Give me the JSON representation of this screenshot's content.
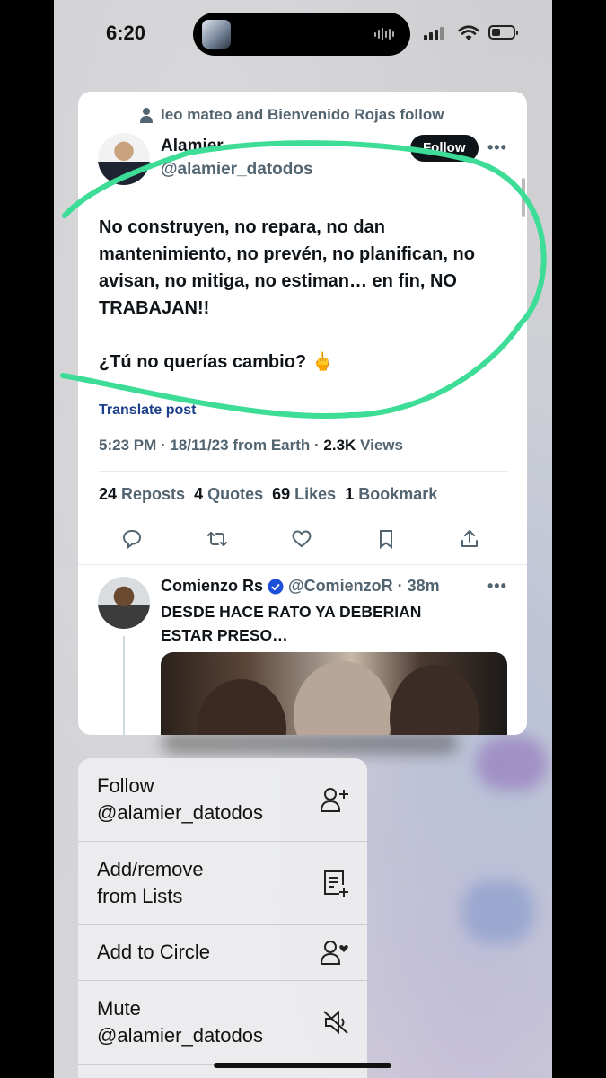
{
  "status_bar": {
    "time": "6:20"
  },
  "tweet": {
    "social_context": "leo mateo and Bienvenido Rojas follow",
    "author_name": "Alamier",
    "author_handle": "@alamier_datodos",
    "follow_label": "Follow",
    "body": "No construyen, no repara, no dan mantenimiento, no prevén, no planifican, no avisan, no mitiga, no estiman… en fin, NO TRABAJAN!!\n\n¿Tú no querías cambio? 🖕",
    "translate_label": "Translate post",
    "time": "5:23 PM",
    "date": "18/11/23",
    "source": "from Earth",
    "views_count": "2.3K",
    "views_label": "Views",
    "reposts_count": "24",
    "reposts_label": "Reposts",
    "quotes_count": "4",
    "quotes_label": "Quotes",
    "likes_count": "69",
    "likes_label": "Likes",
    "bookmarks_count": "1",
    "bookmarks_label": "Bookmark"
  },
  "reply": {
    "name": "Comienzo Rs",
    "handle": "@ComienzoR",
    "time": "38m",
    "body": "DESDE HACE RATO YA DEBERIAN ESTAR PRESO…"
  },
  "menu": {
    "items": [
      {
        "label": "Follow\n@alamier_datodos",
        "icon": "follow-icon"
      },
      {
        "label": "Add/remove\nfrom Lists",
        "icon": "list-add-icon"
      },
      {
        "label": "Add to Circle",
        "icon": "circle-icon"
      },
      {
        "label": "Mute\n@alamier_datodos",
        "icon": "mute-icon"
      }
    ]
  },
  "colors": {
    "highlight": "#3ddc97",
    "follow_button": "#0f1419",
    "link": "#1d3f8a"
  }
}
